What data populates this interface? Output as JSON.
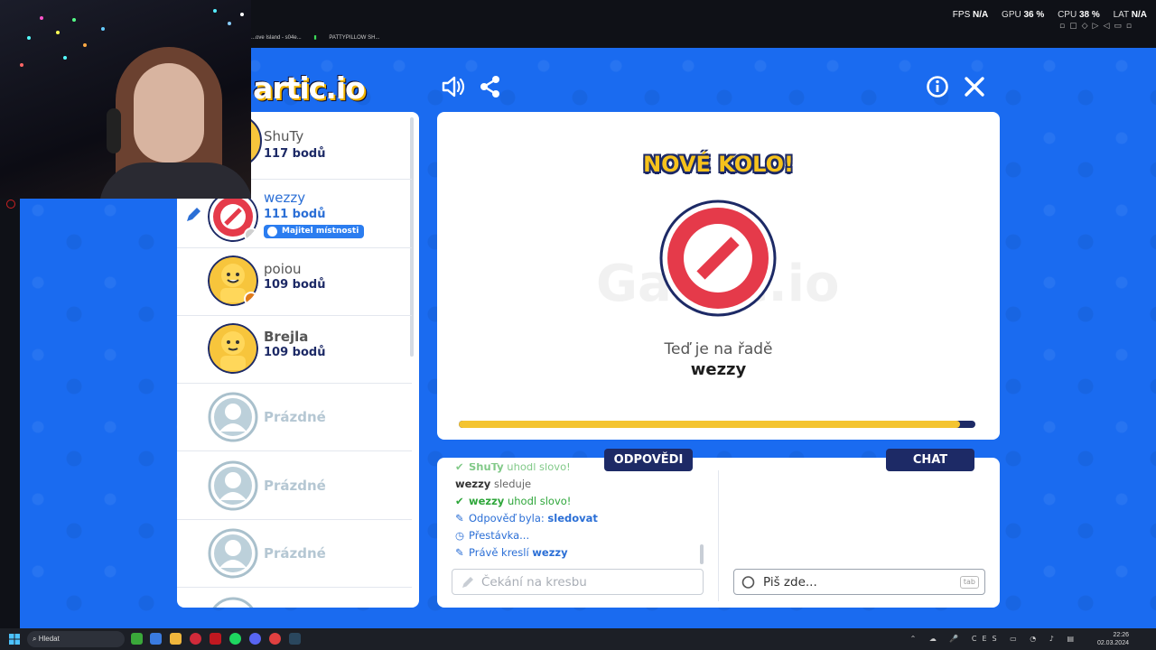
{
  "overlay": {
    "fps_label": "FPS",
    "fps_value": "N/A",
    "gpu_label": "GPU",
    "gpu_value": "36 %",
    "cpu_label": "CPU",
    "cpu_value": "38 %",
    "lat_label": "LAT",
    "lat_value": "N/A"
  },
  "browser_tabs": [
    "...ove Island - s04e...",
    "PATTYPILLOW SH..."
  ],
  "game": {
    "logo": "artic.io",
    "watermark": "Gartic.io"
  },
  "players": [
    {
      "name": "ShuTy",
      "score": "117 bodů",
      "avatar_color": "#f7c53c"
    },
    {
      "name": "wezzy",
      "score": "111 bodů",
      "badge": "Majitel místnosti",
      "drawing": true
    },
    {
      "name": "poiou",
      "score": "109 bodů"
    },
    {
      "name": "Brejla",
      "score": "109 bodů"
    }
  ],
  "empty_slot_label": "Prázdné",
  "round": {
    "title": "NOVÉ KOLO!",
    "turn_label": "Teď je na řadě",
    "turn_player": "wezzy",
    "progress": 0.97
  },
  "tabs": {
    "answers": "ODPOVĚDI",
    "chat": "CHAT"
  },
  "answers_log": [
    {
      "icon": "✔",
      "type": "g",
      "parts": [
        "ShuTy",
        " uhodl slovo!"
      ],
      "faded": true
    },
    {
      "icon": "",
      "type": "k",
      "parts": [
        "wezzy",
        " sleduje"
      ]
    },
    {
      "icon": "✔",
      "type": "g",
      "parts": [
        "wezzy",
        " uhodl slovo!"
      ]
    },
    {
      "icon": "✎",
      "type": "b",
      "parts": [
        "Odpověď byla: ",
        "sledovat"
      ]
    },
    {
      "icon": "◷",
      "type": "b",
      "parts": [
        "Přestávka...",
        ""
      ]
    },
    {
      "icon": "✎",
      "type": "b",
      "parts": [
        "Právě kreslí ",
        "wezzy"
      ]
    }
  ],
  "answer_input": {
    "placeholder": "Čekání na kresbu"
  },
  "chat_input": {
    "placeholder": "Piš zde...",
    "key_hint": "tab"
  },
  "taskbar": {
    "search_label": "Hledat",
    "time": "22:26",
    "date": "02.03.2024",
    "lang": "CES"
  },
  "colors": {
    "game_bg": "#1a6bf0",
    "navy": "#1d2a66",
    "yellow": "#f4c430",
    "red": "#e53a4a"
  }
}
